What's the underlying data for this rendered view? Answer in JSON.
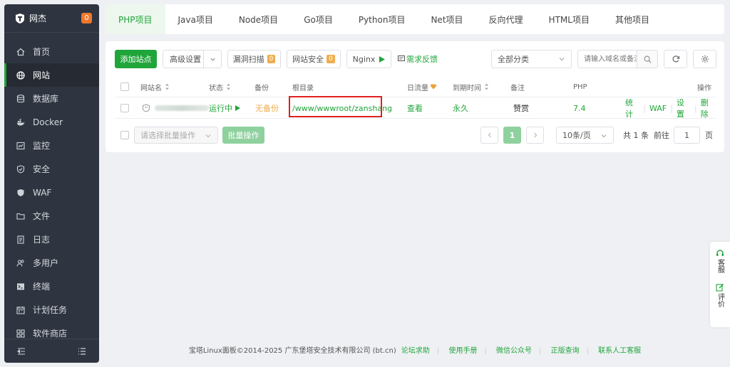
{
  "sidebar": {
    "brand": "网杰",
    "badge": "0",
    "items": [
      {
        "label": "首页",
        "icon": "home-icon"
      },
      {
        "label": "网站",
        "icon": "globe-icon"
      },
      {
        "label": "数据库",
        "icon": "database-icon"
      },
      {
        "label": "Docker",
        "icon": "docker-icon"
      },
      {
        "label": "监控",
        "icon": "monitor-icon"
      },
      {
        "label": "安全",
        "icon": "shield-icon"
      },
      {
        "label": "WAF",
        "icon": "waf-shield-icon"
      },
      {
        "label": "文件",
        "icon": "folder-icon"
      },
      {
        "label": "日志",
        "icon": "log-icon"
      },
      {
        "label": "多用户",
        "icon": "users-icon"
      },
      {
        "label": "终端",
        "icon": "terminal-icon"
      },
      {
        "label": "计划任务",
        "icon": "calendar-icon"
      },
      {
        "label": "软件商店",
        "icon": "grid-icon"
      }
    ]
  },
  "tabs": [
    "PHP项目",
    "Java项目",
    "Node项目",
    "Go项目",
    "Python项目",
    "Net项目",
    "反向代理",
    "HTML项目",
    "其他项目"
  ],
  "toolbar": {
    "add_site": "添加站点",
    "advanced": "高级设置",
    "vuln_scan": "漏洞扫描",
    "vuln_count": "0",
    "site_security": "网站安全",
    "security_count": "0",
    "nginx": "Nginx",
    "feedback": "需求反馈",
    "category": "全部分类",
    "search_placeholder": "请输入域名或备注"
  },
  "table": {
    "headers": {
      "name": "网站名",
      "status": "状态",
      "backup": "备份",
      "root": "根目录",
      "traffic": "日流量",
      "expire": "到期时间",
      "remark": "备注",
      "php": "PHP",
      "ops": "操作"
    },
    "rows": [
      {
        "status": "运行中",
        "backup": "无备份",
        "root": "/www/wwwroot/zanshang",
        "traffic": "查看",
        "expire": "永久",
        "remark": "赞赏",
        "php": "7.4",
        "ops": [
          "统计",
          "WAF",
          "设置",
          "删除"
        ]
      }
    ]
  },
  "bulk": {
    "placeholder": "请选择批量操作",
    "button": "批量操作"
  },
  "pagination": {
    "current": "1",
    "per_page": "10条/页",
    "total_prefix": "共",
    "total": "1",
    "total_suffix": "条",
    "goto_label": "前往",
    "goto_value": "1",
    "page_suffix": "页"
  },
  "float": {
    "service": "客服",
    "rate": "评价"
  },
  "footer": {
    "copyright": "宝塔Linux面板©2014-2025 广东堡塔安全技术有限公司 (bt.cn)",
    "links": [
      "论坛求助",
      "使用手册",
      "微信公众号",
      "正版查询",
      "联系人工客服"
    ]
  },
  "colors": {
    "accent": "#20a53a",
    "sidebar": "#2f3540",
    "warning": "#f0ad4e",
    "highlight": "#e02020"
  }
}
